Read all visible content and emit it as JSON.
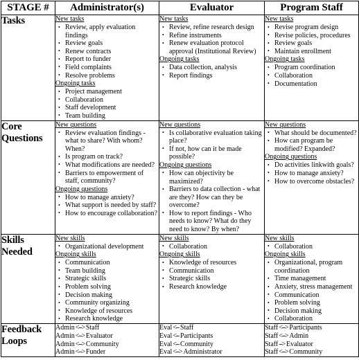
{
  "table": {
    "headers": [
      {
        "label": "STAGE #",
        "name": "stage"
      },
      {
        "label": "Administrator(s)",
        "name": "administrators"
      },
      {
        "label": "Evaluator",
        "name": "evaluator"
      },
      {
        "label": "Program Staff",
        "name": "program-staff"
      }
    ],
    "rows": [
      {
        "stage": "Tasks",
        "administrators": {
          "groups": [
            {
              "title": "New tasks",
              "items": [
                "Review, apply evaluation findings",
                "Review goals",
                "Renew contracts",
                "Report to funder",
                "Field complaints",
                "Resolve problems"
              ]
            },
            {
              "title": "Ongoing tasks",
              "items": [
                "Project management",
                "Collaboration",
                "Staff development",
                "Team building"
              ]
            }
          ]
        },
        "evaluator": {
          "groups": [
            {
              "title": "New tasks",
              "items": [
                "Review, refine research design",
                "Refine instruments",
                "Renew evaluation protocol approval (Institutional Review)"
              ]
            },
            {
              "title": "Ongoing tasks",
              "items": [
                "Data collection, analysis",
                "Report findings"
              ]
            }
          ]
        },
        "program_staff": {
          "groups": [
            {
              "title": "New tasks",
              "items": [
                "Revise program design",
                "Revise policies, procedures",
                "Review goals",
                "Maintain enrollment"
              ]
            },
            {
              "title": "Ongoing tasks",
              "items": [
                "Program coordination",
                "Collaboration",
                "Documentation"
              ]
            }
          ]
        }
      },
      {
        "stage": "Core Questions",
        "administrators": {
          "groups": [
            {
              "title": "New questions",
              "items": [
                "Review evaluation findings - what to share?  With whom?  When?",
                "Is program on track?",
                "What modifications are needed?",
                "Barriers to empowerment of staff, community?"
              ]
            },
            {
              "title": "Ongoing questions",
              "items": [
                "How to manage anxiety?",
                "What support is needed by staff?",
                "How to encourage collaboration?"
              ]
            }
          ]
        },
        "evaluator": {
          "groups": [
            {
              "title": "New questions",
              "items": [
                "Is collaborative evaluation taking place?",
                "If not, how can it be made possible?"
              ]
            },
            {
              "title": "Ongoing questions",
              "items": [
                "How can objectivity be maximized?",
                "Barriers to data collection - what are they? How can they be overcome?",
                "How to report findings - Who needs to know? What do they need to know? By when?"
              ]
            }
          ]
        },
        "program_staff": {
          "groups": [
            {
              "title": "New questions",
              "items": [
                "What should be documented?",
                "How can program be modified? Expanded?"
              ]
            },
            {
              "title": "Ongoing questions",
              "items": [
                "Do activities linkwith goals?",
                "How to manage anxiety?",
                "How to overcome obstacles?"
              ]
            }
          ]
        }
      },
      {
        "stage": "Skills Needed",
        "administrators": {
          "groups": [
            {
              "title": "New skills",
              "items": [
                "Organizational development"
              ]
            },
            {
              "title": "Ongoing skills",
              "items": [
                "Communication",
                "Team building",
                "Strategic skills",
                "Problem solving",
                "Decision making",
                "Community organizing",
                "Knowledge of resources",
                "Research knowledge"
              ]
            }
          ]
        },
        "evaluator": {
          "groups": [
            {
              "title": "New skills",
              "items": [
                "Collaboration"
              ]
            },
            {
              "title": "Ongoing skills",
              "items": [
                "Knowledge of resources",
                "Communication",
                "Strategic skills",
                "Research knowledge"
              ]
            }
          ]
        },
        "program_staff": {
          "groups": [
            {
              "title": "New skills",
              "items": [
                "Collaboration"
              ]
            },
            {
              "title": "Ongoing skills",
              "items": [
                "Organizational, program coordination",
                "Time management",
                "Anxiety, stress management",
                "Communication",
                "Problem solving",
                "Decision making",
                "Collaboration"
              ]
            }
          ]
        }
      }
    ],
    "feedback_row": {
      "stage": "Feedback Loops",
      "administrators": [
        {
          "from": "Admin",
          "arrow": "<-->",
          "to": "Staff"
        },
        {
          "from": "Admin",
          "arrow": "<-->",
          "to": "Evaluator"
        },
        {
          "from": "Admin",
          "arrow": "<-->",
          "to": "Community"
        },
        {
          "from": "Admin",
          "arrow": "<-->",
          "to": "Funder"
        }
      ],
      "evaluator": [
        {
          "from": "Eval",
          "arrow": "<--",
          "to": "Staff"
        },
        {
          "from": "Eval",
          "arrow": "<--",
          "to": "Participants"
        },
        {
          "from": "Eval",
          "arrow": "<--",
          "to": "Community"
        },
        {
          "from": "Eval",
          "arrow": "<-->",
          "to": "Administrator"
        }
      ],
      "program_staff": [
        {
          "from": "Staff",
          "arrow": "<-->",
          "to": "Participants"
        },
        {
          "from": "Staff",
          "arrow": "<-->",
          "to": "Admin"
        },
        {
          "from": "Staff",
          "arrow": "-->",
          "to": "Evaluator"
        },
        {
          "from": "Staff",
          "arrow": "<-->",
          "to": "Community"
        }
      ]
    }
  }
}
